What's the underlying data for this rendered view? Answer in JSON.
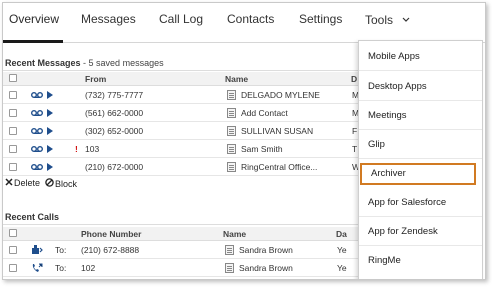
{
  "nav": {
    "tabs": [
      {
        "label": "Overview"
      },
      {
        "label": "Messages"
      },
      {
        "label": "Call Log"
      },
      {
        "label": "Contacts"
      },
      {
        "label": "Settings"
      },
      {
        "label": "Tools"
      }
    ]
  },
  "recent_messages": {
    "title": "Recent Messages",
    "subtitle": " - 5 saved messages",
    "headers": {
      "from": "From",
      "name": "Name",
      "date": "D"
    },
    "rows": [
      {
        "from": "(732) 775-7777",
        "name": "DELGADO MYLENE",
        "date": "M"
      },
      {
        "from": "(561) 662-0000",
        "name": "Add Contact",
        "date": "M"
      },
      {
        "from": "(302) 652-0000",
        "name": "SULLIVAN SUSAN",
        "date": "F"
      },
      {
        "from": "103",
        "name": "Sam Smith",
        "date": "T",
        "flag": "!"
      },
      {
        "from": "(210) 672-0000",
        "name": "RingCentral Office...",
        "date": "W"
      }
    ],
    "actions": {
      "delete": "Delete",
      "block": "Block"
    }
  },
  "recent_calls": {
    "title": "Recent Calls",
    "headers": {
      "phone": "Phone Number",
      "name": "Name",
      "date": "Da"
    },
    "rows": [
      {
        "dir": "To:",
        "phone": "(210) 672-8888",
        "name": "Sandra Brown",
        "date": "Ye"
      },
      {
        "dir": "To:",
        "phone": "102",
        "name": "Sandra Brown",
        "date": "Ye"
      }
    ]
  },
  "tools_menu": {
    "items": [
      {
        "label": "Mobile Apps"
      },
      {
        "label": "Desktop Apps"
      },
      {
        "label": "Meetings"
      },
      {
        "label": "Glip"
      },
      {
        "label": "Archiver"
      },
      {
        "label": "App for Salesforce"
      },
      {
        "label": "App for Zendesk"
      },
      {
        "label": "RingMe"
      }
    ],
    "highlight_color": "#d17a22"
  },
  "colors": {
    "accent": "#d17a22",
    "icon_blue": "#1f4e8c",
    "flag_red": "#d01010"
  }
}
